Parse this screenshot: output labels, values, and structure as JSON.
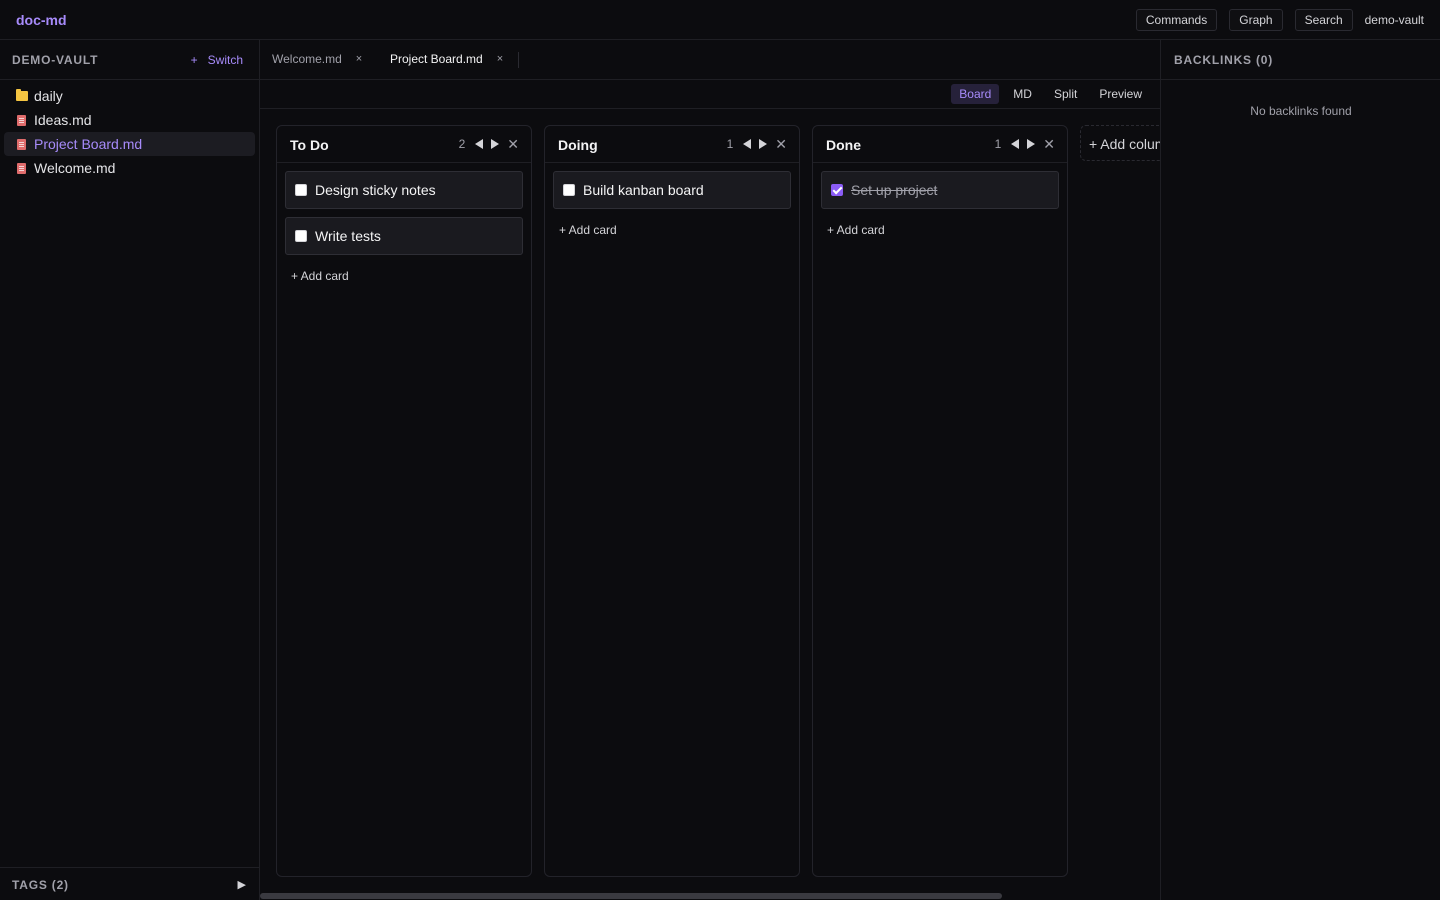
{
  "app": {
    "name": "doc-md"
  },
  "topbar": {
    "buttons": [
      "Commands",
      "Graph",
      "Search"
    ],
    "vault": "demo-vault"
  },
  "sidebar": {
    "title": "DEMO-VAULT",
    "switch_icon": "+",
    "switch_label": "Switch",
    "items": [
      {
        "label": "daily",
        "icon": "folder-icon"
      },
      {
        "label": "Ideas.md",
        "icon": "file-icon"
      },
      {
        "label": "Project Board.md",
        "icon": "file-icon",
        "active": true
      },
      {
        "label": "Welcome.md",
        "icon": "file-icon"
      }
    ],
    "tags_label": "TAGS (2)"
  },
  "tabs": [
    {
      "label": "Welcome.md",
      "close": "×"
    },
    {
      "label": "Project Board.md",
      "close": "×",
      "active": true
    }
  ],
  "views": [
    {
      "label": "Board",
      "active": true
    },
    {
      "label": "MD"
    },
    {
      "label": "Split"
    },
    {
      "label": "Preview"
    }
  ],
  "board": {
    "columns": [
      {
        "title": "To Do",
        "count": "2",
        "cards": [
          {
            "text": "Design sticky notes",
            "checked": false
          },
          {
            "text": "Write tests",
            "checked": false
          }
        ]
      },
      {
        "title": "Doing",
        "count": "1",
        "cards": [
          {
            "text": "Build kanban board",
            "checked": false
          }
        ]
      },
      {
        "title": "Done",
        "count": "1",
        "cards": [
          {
            "text": "Set up project",
            "checked": true
          }
        ]
      }
    ],
    "add_card_label": "+ Add card",
    "add_column_label": "+ Add column"
  },
  "backlinks": {
    "title": "BACKLINKS (0)",
    "empty": "No backlinks found"
  },
  "colors": {
    "accent": "#a78bfa",
    "background": "#0c0c0f",
    "card": "#1a1a1f",
    "border": "#1f1f24"
  }
}
